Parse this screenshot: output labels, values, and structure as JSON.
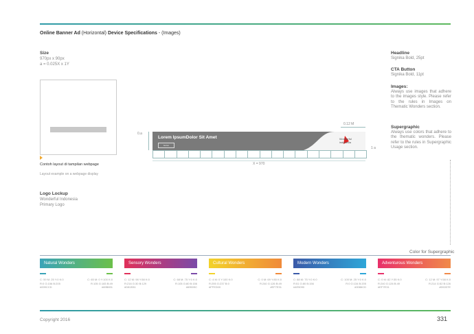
{
  "header": {
    "title_bold": "Online Banner Ad",
    "title_mid": " (Horizontal) ",
    "title_bold2": "Device Specifications",
    "title_end": " - (Images)"
  },
  "size": {
    "heading": "Size",
    "line1": "970px x 90px",
    "line2": "a = 0.025X x 1Y"
  },
  "caption": {
    "id": "Contoh layout di tampilan webpage",
    "en": "Layout example on a webpage display"
  },
  "logo_lockup": {
    "heading": "Logo Lockup",
    "line1": "Wonderful Indonesia",
    "line2": "Primary Logo"
  },
  "banner": {
    "headline": "Lorem IpsumDolor Sit Amet",
    "cta": "button",
    "logo_line1": "Wonderful",
    "logo_line2": "indonesia",
    "dim_width": "X = 970",
    "dim_left": "0.a",
    "dim_top": "0.12 M",
    "dim_right": "1 a"
  },
  "specs": {
    "headline_h": "Headline",
    "headline_v": "Signika Bold, 25pt",
    "cta_h": "CTA Button",
    "cta_v": "Signika Bold, 11pt",
    "images_h": "Images:",
    "images_v": "Always use images that adhere to the images style. Please refer to the rules in Images on Thematic Wonders section.",
    "super_h": "Supergraphic",
    "super_v": "Always use colors that adhere to the thematic wonders. Please refer to the rules in Supergraphic Usage section."
  },
  "supergraphic_label": "Color for Supergraphic",
  "wonders": [
    {
      "name": "Natural Wonders",
      "grad": [
        "#3aa3b8",
        "#6cc04a"
      ],
      "c1": "#3aa3b8",
      "c2": "#6cc04a",
      "t1": [
        "C: 59 M: 25 Y:0 K:0",
        "R:0 G:156 B:205",
        "#009CCD"
      ],
      "t2": [
        "C: 65 M: 0 Y:100 K:0",
        "R:105 G:183 B:49",
        "#69B831"
      ]
    },
    {
      "name": "Sensory Wonders",
      "grad": [
        "#e0305a",
        "#7a4aa8"
      ],
      "c1": "#e0305a",
      "c2": "#7a4aa8",
      "t1": [
        "C: 12 M: 98 Y:58 K:0",
        "R:216 G:30 B:129",
        "#D81E81"
      ],
      "t2": [
        "C: 68 M: 75 Y:0 K:0",
        "R:105 G:80 B:156",
        "#69509C"
      ]
    },
    {
      "name": "Cultural Wonders",
      "grad": [
        "#f2d22a",
        "#f08a3a"
      ],
      "c1": "#f2d22a",
      "c2": "#f08a3a",
      "t1": [
        "C: 4 M: 0 Y:100 K:0",
        "R:255 G:237 B:0",
        "#FFED00"
      ],
      "t2": [
        "C: 0 M: 69 Y:85 K:0",
        "R:240 G:126 B:49",
        "#EF7E31"
      ]
    },
    {
      "name": "Modern Wonders",
      "grad": [
        "#3a5aa8",
        "#2ea6d8"
      ],
      "c1": "#3a5aa8",
      "c2": "#2ea6d8",
      "t1": [
        "C: 88 M: 75 Y:0 K:0",
        "R:51 G:80 B:156",
        "#4E5090"
      ],
      "t2": [
        "C: 100 M: 25 Y:0 K:0",
        "R:0 G:134 B:205",
        "#0086CD"
      ]
    },
    {
      "name": "Adventurous Wonders",
      "grad": [
        "#e8306a",
        "#f08a4a"
      ],
      "c1": "#e8306a",
      "c2": "#f08a4a",
      "t1": [
        "C: 0 M: 82 Y:35 K:0",
        "R:240 G:126 B:49",
        "#EF7E31"
      ],
      "t2": [
        "C: 12 M: 97 Y:58 K:0",
        "R:214 G:52 B:126",
        "#D5337E"
      ]
    }
  ],
  "footer": {
    "copyright": "Copyright 2016",
    "page": "331"
  }
}
